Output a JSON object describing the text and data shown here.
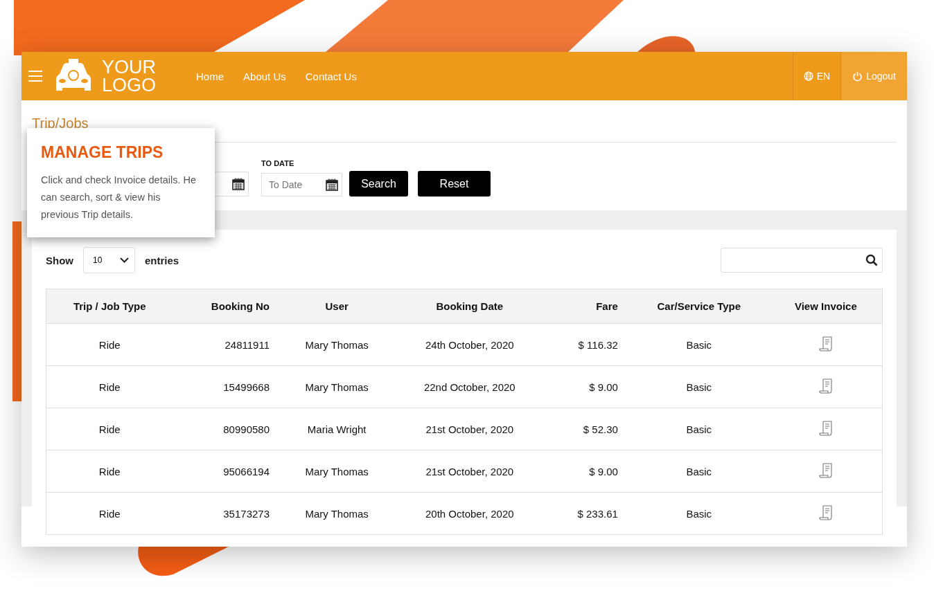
{
  "header": {
    "logo_line1": "YOUR",
    "logo_line2": "LOGO",
    "nav": [
      {
        "label": "Home"
      },
      {
        "label": "About Us"
      },
      {
        "label": "Contact Us"
      }
    ],
    "language": "EN",
    "logout": "Logout"
  },
  "page_title": "Trip/Jobs",
  "filters": {
    "to_date_label": "TO DATE",
    "to_date_placeholder": "To Date",
    "search_button": "Search",
    "reset_button": "Reset"
  },
  "popup": {
    "title": "MANAGE TRIPS",
    "text": "Click and check Invoice details. He can search, sort & view his previous Trip details."
  },
  "table_controls": {
    "show_label": "Show",
    "page_size": "10",
    "entries_label": "entries"
  },
  "table": {
    "columns": [
      {
        "label": "Trip / Job Type"
      },
      {
        "label": "Booking No"
      },
      {
        "label": "User"
      },
      {
        "label": "Booking Date"
      },
      {
        "label": "Fare"
      },
      {
        "label": "Car/Service Type"
      },
      {
        "label": "View Invoice"
      }
    ],
    "rows": [
      {
        "type": "Ride",
        "booking_no": "24811911",
        "user": "Mary Thomas",
        "date": "24th October, 2020",
        "fare": "$ 116.32",
        "service": "Basic"
      },
      {
        "type": "Ride",
        "booking_no": "15499668",
        "user": "Mary Thomas",
        "date": "22nd October, 2020",
        "fare": "$ 9.00",
        "service": "Basic"
      },
      {
        "type": "Ride",
        "booking_no": "80990580",
        "user": "Maria Wright",
        "date": "21st October, 2020",
        "fare": "$ 52.30",
        "service": "Basic"
      },
      {
        "type": "Ride",
        "booking_no": "95066194",
        "user": "Mary Thomas",
        "date": "21st October, 2020",
        "fare": "$ 9.00",
        "service": "Basic"
      },
      {
        "type": "Ride",
        "booking_no": "35173273",
        "user": "Mary Thomas",
        "date": "20th October, 2020",
        "fare": "$ 233.61",
        "service": "Basic"
      }
    ]
  }
}
